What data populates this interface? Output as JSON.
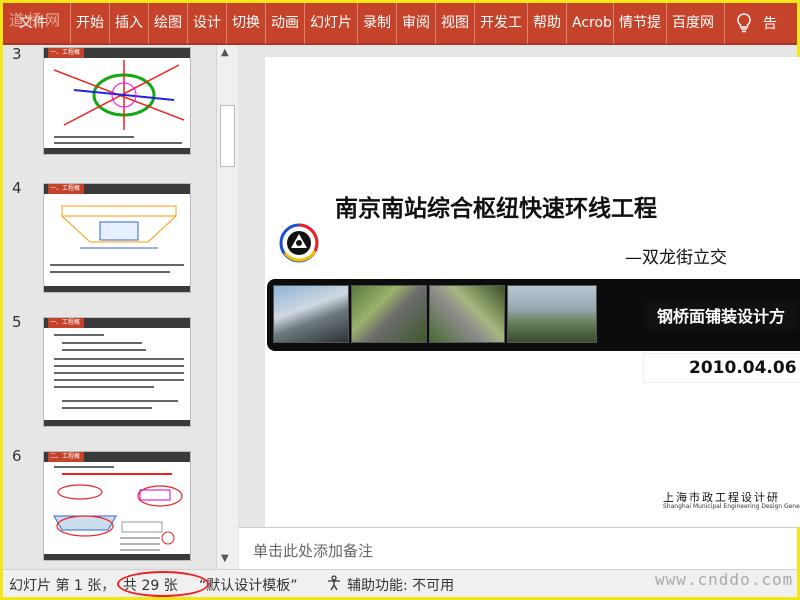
{
  "watermark": "道桥网",
  "ribbon": {
    "tabs": [
      "文件",
      "开始",
      "插入",
      "绘图",
      "设计",
      "切换",
      "动画",
      "幻灯片",
      "录制",
      "审阅",
      "视图",
      "开发工",
      "帮助",
      "Acrob",
      "情节提",
      "百度网"
    ],
    "tell_me": "告"
  },
  "thumbnails": [
    {
      "number": "3",
      "header": "一、工程概况"
    },
    {
      "number": "4",
      "header": "一、工程概况"
    },
    {
      "number": "5",
      "header": "一、工程概况"
    },
    {
      "number": "6",
      "header": "二、工程概况"
    }
  ],
  "slide": {
    "title": "南京南站综合枢纽快速环线工程",
    "subtitle": "—双龙街立交",
    "banner_text": "钢桥面铺装设计方",
    "date": "2010.04.06",
    "org": "上海市政工程设计研",
    "org_en": "Shanghai Municipal Engineering Design Gene"
  },
  "notes": {
    "placeholder": "单击此处添加备注"
  },
  "status": {
    "slide_info": "幻灯片 第 1 张，",
    "total": "共 29 张",
    "template": "“默认设计模板”",
    "accessibility": "辅助功能: 不可用"
  },
  "site_mark": "www.cnddo.com",
  "colors": {
    "ribbon": "#c5432b",
    "highlight_circle": "#ee2222"
  }
}
